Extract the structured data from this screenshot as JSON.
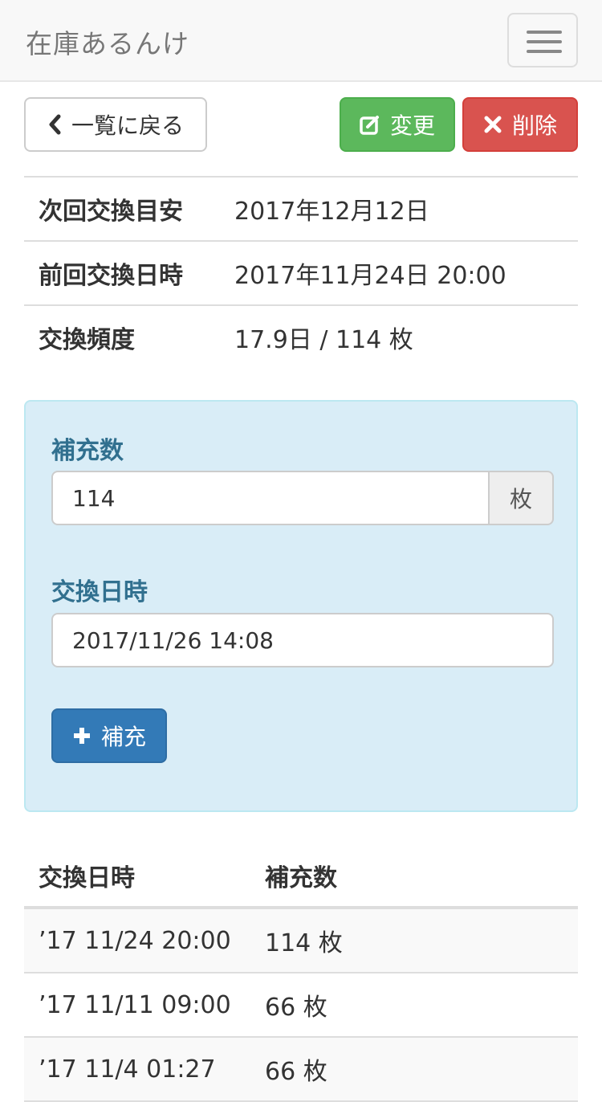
{
  "app": {
    "title": "在庫あるんけ"
  },
  "actions": {
    "back_label": "一覧に戻る",
    "edit_label": "変更",
    "delete_label": "削除"
  },
  "info": [
    {
      "key": "次回交換目安",
      "value": "2017年12月12日"
    },
    {
      "key": "前回交換日時",
      "value": "2017年11月24日 20:00"
    },
    {
      "key": "交換頻度",
      "value": "17.9日 / 114 枚"
    }
  ],
  "form": {
    "qty_label": "補充数",
    "qty_value": "114",
    "qty_unit": "枚",
    "date_label": "交換日時",
    "date_value": "2017/11/26 14:08",
    "submit_label": "補充"
  },
  "history": {
    "headers": [
      "交換日時",
      "補充数"
    ],
    "rows": [
      {
        "date": "’17 11/24 20:00",
        "qty": "114 枚"
      },
      {
        "date": "’17 11/11 09:00",
        "qty": "66 枚"
      },
      {
        "date": "’17 11/4 01:27",
        "qty": "66 枚"
      }
    ]
  },
  "colors": {
    "edit": "#5cb85c",
    "delete": "#d9534f",
    "primary": "#337ab7",
    "panel_bg": "#d9edf7",
    "label": "#31708f"
  }
}
